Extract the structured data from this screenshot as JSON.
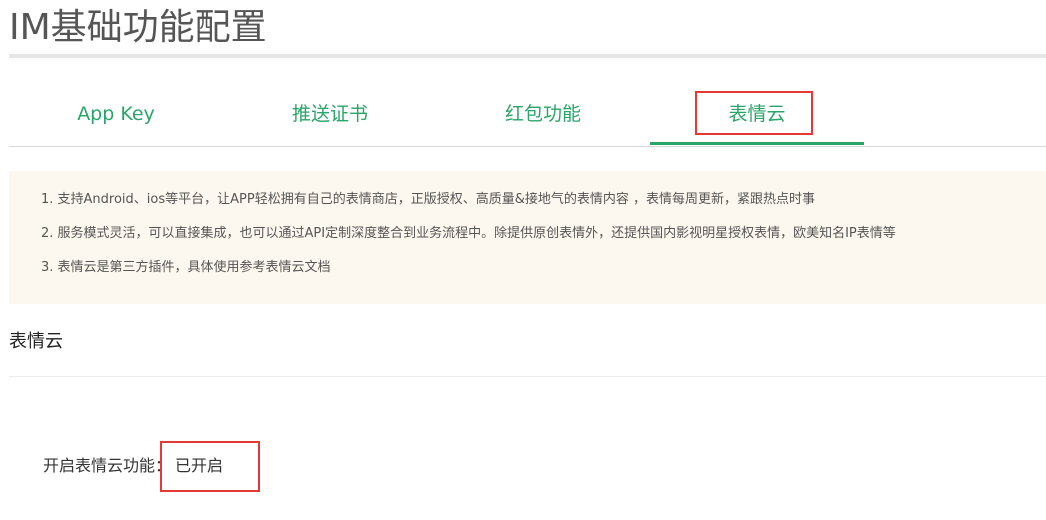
{
  "page": {
    "title": "IM基础功能配置"
  },
  "tabs": [
    {
      "label": "App Key",
      "active": false
    },
    {
      "label": "推送证书",
      "active": false
    },
    {
      "label": "红包功能",
      "active": false
    },
    {
      "label": "表情云",
      "active": true
    }
  ],
  "notice": {
    "items": [
      "1. 支持Android、ios等平台，让APP轻松拥有自己的表情商店，正版授权、高质量&接地气的表情内容 ，表情每周更新，紧跟热点时事",
      "2. 服务模式灵活，可以直接集成，也可以通过API定制深度整合到业务流程中。除提供原创表情外，还提供国内影视明星授权表情，欧美知名IP表情等",
      "3. 表情云是第三方插件，具体使用参考表情云文档"
    ]
  },
  "section": {
    "title": "表情云"
  },
  "setting": {
    "label": "开启表情云功能：",
    "value": "已开启"
  },
  "colors": {
    "accent": "#2aa569",
    "highlight": "#e53935",
    "notice_bg": "#fdf8ef"
  }
}
